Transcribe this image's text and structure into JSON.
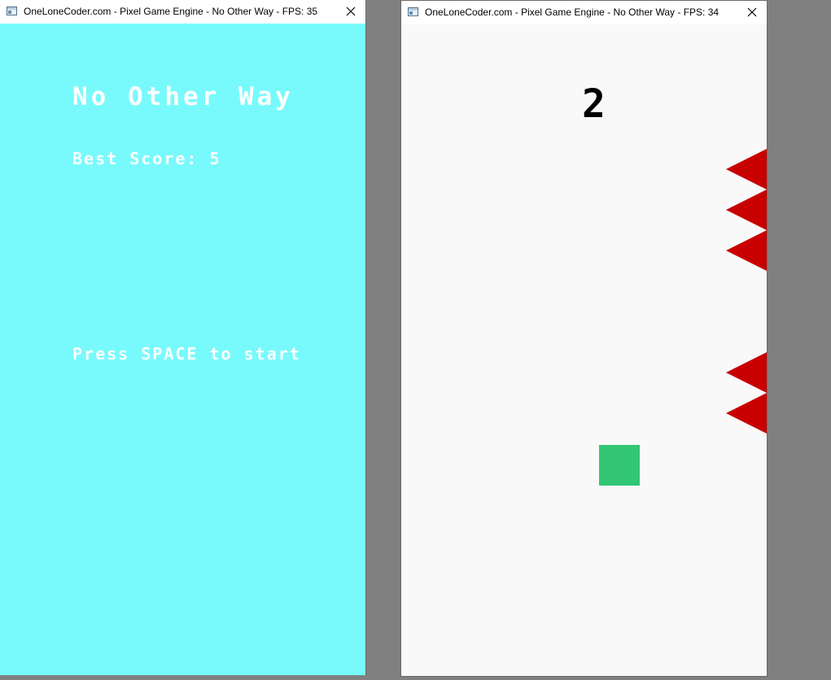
{
  "windows": [
    {
      "title": "OneLoneCoder.com - Pixel Game Engine - No Other Way - FPS: 35",
      "screen": "title",
      "background": "#78fafc",
      "game_title": "No Other Way",
      "best_score": "Best Score: 5",
      "start_prompt": "Press SPACE to start"
    },
    {
      "title": "OneLoneCoder.com - Pixel Game Engine - No Other Way - FPS: 34",
      "screen": "gameplay",
      "background": "#f9f9f9",
      "score": "2",
      "player_color": "#32c675",
      "spike_color": "#c80000",
      "spike_side": "right"
    }
  ],
  "icons": {
    "window_icon": "app-window-icon",
    "close": "close-icon"
  }
}
